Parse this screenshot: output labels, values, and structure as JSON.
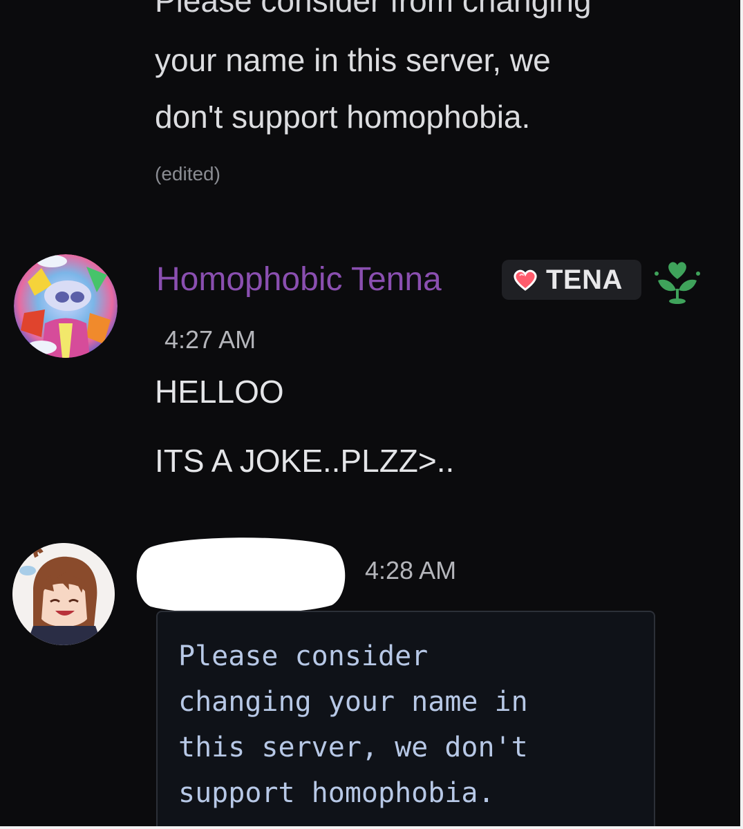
{
  "previous_message": {
    "lines": [
      "Please consider from changing",
      "your name in this server, we",
      "don't support homophobia."
    ],
    "edited_label": "(edited)"
  },
  "message_1": {
    "username": "Homophobic Tenna",
    "username_color": "#8a4fb0",
    "role_tag": {
      "label": "TENA",
      "icon": "heart-icon"
    },
    "role_icon": "green-heart-flower-icon",
    "timestamp": "4:27 AM",
    "lines": [
      "HELLOO",
      "ITS A JOKE..PLZZ>.."
    ]
  },
  "message_2": {
    "username_redacted": true,
    "timestamp": "4:28 AM",
    "code_block": {
      "lines": [
        "Please consider",
        "changing your name in",
        "this server, we don't",
        "support homophobia."
      ]
    }
  }
}
